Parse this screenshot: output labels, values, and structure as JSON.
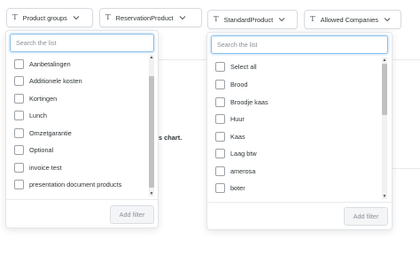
{
  "filters": {
    "product_groups": "Product groups",
    "reservation_product": "ReservationProduct",
    "standard_product": "StandardProduct",
    "allowed_companies": "Allowed Companies"
  },
  "background": {
    "text_fragment": "s chart."
  },
  "left_panel": {
    "search_placeholder": "Search the list",
    "items": [
      "Aanbetalingen",
      "Additionele kosten",
      "Kortingen",
      "Lunch",
      "Omzetgarantie",
      "Optional",
      "invoice test",
      "presentation document products"
    ],
    "add_filter_label": "Add filter"
  },
  "right_panel": {
    "search_placeholder": "Search the list",
    "items": [
      "Select all",
      "Brood",
      "Broodje kaas",
      "Huur",
      "Kaas",
      "Laag btw",
      "amerosa",
      "boter"
    ],
    "add_filter_label": "Add filter"
  },
  "icons": {
    "text_type": "T",
    "chevron": "chevron-down-icon"
  }
}
